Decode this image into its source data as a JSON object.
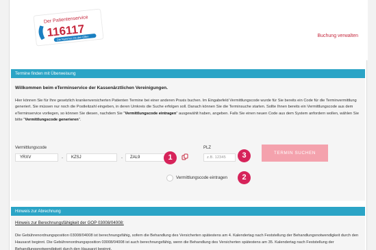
{
  "header": {
    "logo": {
      "line1": "Der Patientenservice",
      "number": "116117",
      "tagline": "Die Nummer mit den Elfen"
    },
    "manage_link": "Buchung verwalten"
  },
  "referral_panel": {
    "title": "Termine finden mit Überweisung",
    "welcome": "Willkommen beim eTerminservice der Kassenärztlichen Vereinigungen.",
    "intro_1": "Hier können Sie für Ihre gesetzlich krankenversicherten Patienten Termine bei einer anderen Praxis buchen. Im Eingabefeld Vermittlungscode wurde für Sie bereits ein Code für die Terminvermittlung generiert. Sie müssen nur noch die Postleitzahl eingeben, in deren Umkreis die Suche erfolgen soll. Danach können Sie die Terminsuche starten. Sollte Ihnen bereits ein Vermittlungscode aus dem eTerminservice vorliegen, so können Sie diesen, nachdem Sie \"",
    "intro_bold_1": "Vermittlungscode eintragen",
    "intro_2": "\" ausgewählt haben, angeben. Falls Sie einen neuen Code aus dem System anfordern wollen, wählen Sie bitte \"",
    "intro_bold_2": "Vermittlungscode generieren",
    "intro_3": "\".",
    "code_label": "Vermittlungscode",
    "code_parts": [
      "YRXV",
      "KZSJ",
      "ZAL9"
    ],
    "separator": "-",
    "plz_label": "PLZ",
    "plz_placeholder": "z.B. 12345",
    "search_button": "TERMIN SUCHEN",
    "radio_label": "Vermittlungscode eintragen"
  },
  "badges": [
    "1",
    "2",
    "3"
  ],
  "billing_panel": {
    "title": "Hinweis zur Abrechnung",
    "heading": "Hinweis zur Berechnungsfähigkeit der GOP 03008/04008:",
    "text": "Die Gebührenordnungsposition 03008/04008 ist berechnungsfähig, sofern die Behandlung des Versicherten spätestens am 4. Kalendertag nach Feststellung der Behandlungsnotwendigkeit durch den Hausarzt beginnt. Die Gebührenordnungsposition 03008/04008 ist auch berechnungsfähig, wenn die Behandlung des Versicherten spätestens am 35. Kalendertag nach Feststellung der Behandlungsnotwendigkeit durch den Hausarzt beginnt."
  },
  "colors": {
    "accent": "#2ba4c6",
    "brand_red": "#c5283d",
    "badge": "#d6235a",
    "button": "#f4a2ad"
  }
}
